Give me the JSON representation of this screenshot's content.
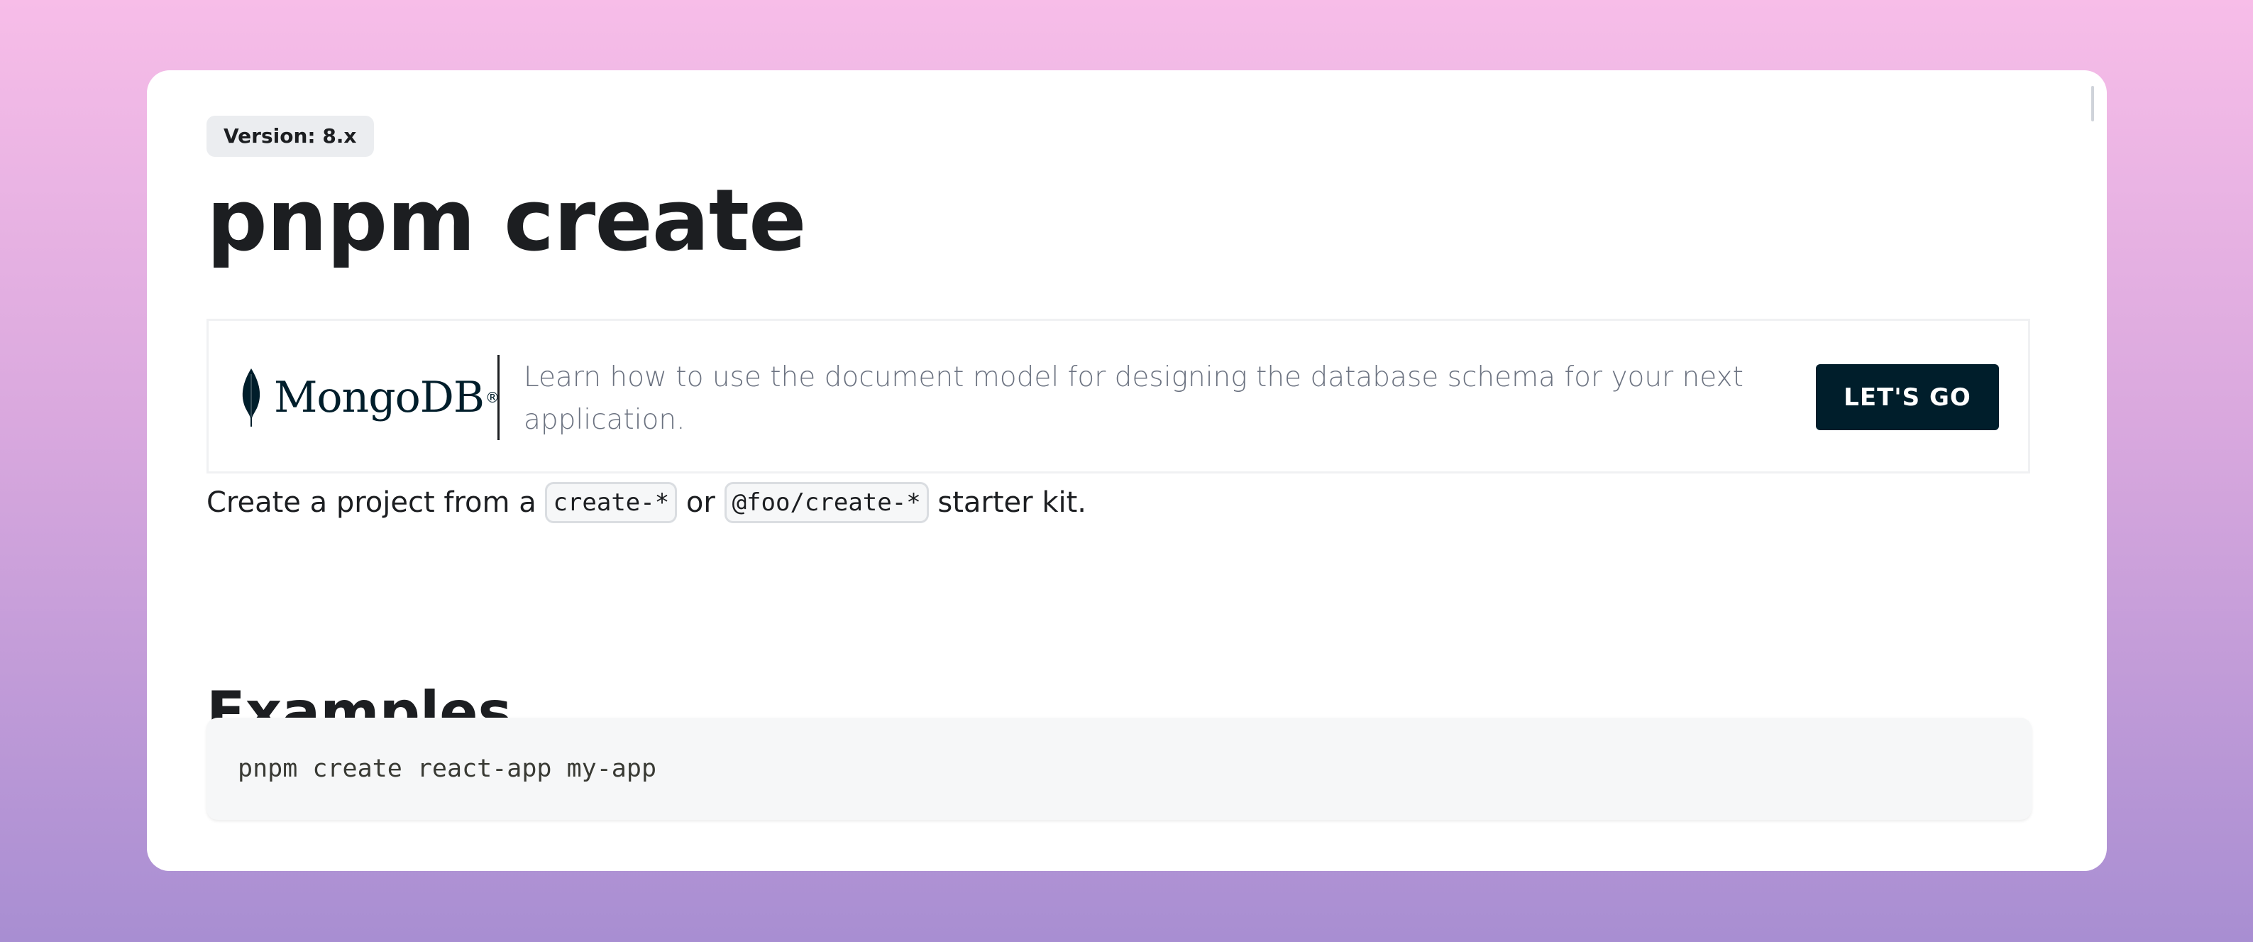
{
  "version_badge": "Version: 8.x",
  "page_title": "pnpm create",
  "ad": {
    "logo_text": "MongoDB",
    "logo_mark": "®",
    "copy": "Learn how to use the document model for designing the database schema for your next application.",
    "cta_label": "LET'S GO",
    "icon": "leaf-icon",
    "colors": {
      "logo_green": "#00684a",
      "button_bg": "#001e2b"
    }
  },
  "intro": {
    "prefix": "Create a project from a",
    "code1": "create-*",
    "middle": "or",
    "code2": "@foo/create-*",
    "suffix": "starter kit."
  },
  "examples": {
    "heading": "Examples",
    "code": "pnpm create react-app my-app"
  }
}
